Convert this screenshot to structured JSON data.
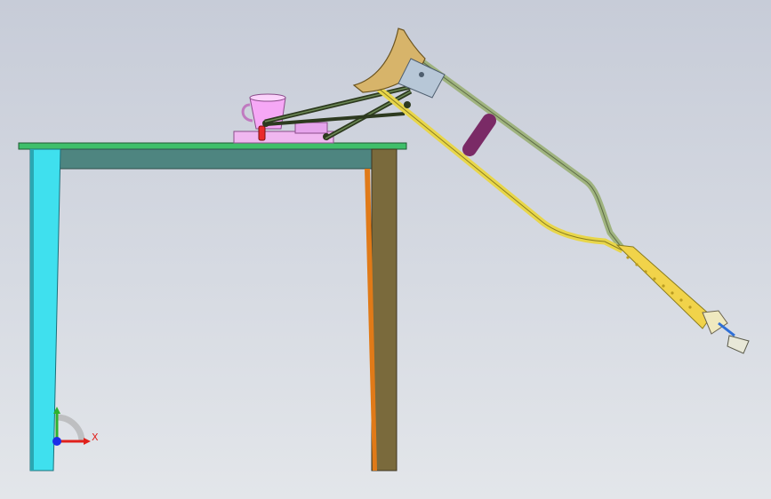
{
  "triad": {
    "x_axis_label": "X",
    "x_axis_color": "#e0201b",
    "y_axis_color": "#2fb12f",
    "z_axis_color": "#1b2ee8"
  },
  "colors": {
    "table_top": "#3fbf6a",
    "table_apron": "#4e8580",
    "table_leg_left": "#3fe0ee",
    "table_leg_right": "#7a6a3c",
    "crutch_frame": "#e8d64a",
    "crutch_rail": "#9fb37f",
    "hand_grip": "#7a2a66",
    "underarm_pad": "#d7b46a",
    "device_base": "#f0b7f0",
    "linkage": "#2d3a1f"
  }
}
